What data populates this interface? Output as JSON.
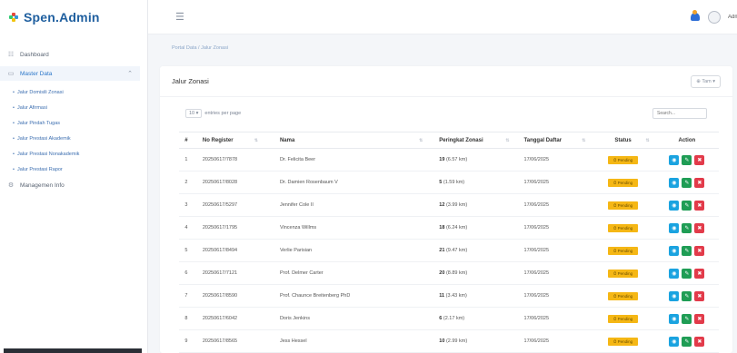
{
  "brand": {
    "name": "Spen.Admin",
    "colors": {
      "primary": "#1f5f9f",
      "accent": "#f5b715"
    }
  },
  "sidebar": {
    "items": [
      {
        "label": "Dashboard",
        "icon": "grid-icon"
      },
      {
        "label": "Master Data",
        "icon": "folder-icon"
      },
      {
        "label": "Managemen Info",
        "icon": "settings-icon"
      }
    ],
    "submenu": [
      {
        "label": "Jalur Domisili Zonasi"
      },
      {
        "label": "Jalur Afirmasi"
      },
      {
        "label": "Jalur Pindah Tugas"
      },
      {
        "label": "Jalur Prestasi Akademik"
      },
      {
        "label": "Jalur Prestasi Nonakademik"
      },
      {
        "label": "Jalur Prestasi Rapor"
      }
    ]
  },
  "header": {
    "user": "Adm"
  },
  "breadcrumb": "Portal Data / Jalur Zonasi",
  "card": {
    "title": "Jalur Zonasi",
    "add_label": "Tam",
    "length_value": "10",
    "length_label": "entries per page",
    "search_placeholder": "Search..."
  },
  "table": {
    "headers": [
      "#",
      "No Register",
      "Nama",
      "Peringkat Zonasi",
      "Tanggal Daftar",
      "Status",
      "Action"
    ],
    "rows": [
      {
        "no": "1",
        "reg": "20250617/7878",
        "nama": "Dr. Felicita Beer",
        "rank": "19",
        "dist": "(6.57 km)",
        "tgl": "17/06/2025",
        "status": "Pending"
      },
      {
        "no": "2",
        "reg": "20250617/8028",
        "nama": "Dr. Damien Rosenbaum V",
        "rank": "5",
        "dist": "(1.59 km)",
        "tgl": "17/06/2025",
        "status": "Pending"
      },
      {
        "no": "3",
        "reg": "20250617/5297",
        "nama": "Jennifer Cole II",
        "rank": "12",
        "dist": "(3.99 km)",
        "tgl": "17/06/2025",
        "status": "Pending"
      },
      {
        "no": "4",
        "reg": "20250617/1795",
        "nama": "Vincenza Willms",
        "rank": "18",
        "dist": "(6.24 km)",
        "tgl": "17/06/2025",
        "status": "Pending"
      },
      {
        "no": "5",
        "reg": "20250617/8494",
        "nama": "Verlie Parisian",
        "rank": "21",
        "dist": "(9.47 km)",
        "tgl": "17/06/2025",
        "status": "Pending"
      },
      {
        "no": "6",
        "reg": "20250617/7121",
        "nama": "Prof. Delmer Carter",
        "rank": "20",
        "dist": "(8.89 km)",
        "tgl": "17/06/2025",
        "status": "Pending"
      },
      {
        "no": "7",
        "reg": "20250617/8590",
        "nama": "Prof. Chaunce Breitenberg PhD",
        "rank": "11",
        "dist": "(3.43 km)",
        "tgl": "17/06/2025",
        "status": "Pending"
      },
      {
        "no": "8",
        "reg": "20250617/6042",
        "nama": "Doris Jenkins",
        "rank": "6",
        "dist": "(2.17 km)",
        "tgl": "17/06/2025",
        "status": "Pending"
      },
      {
        "no": "9",
        "reg": "20250617/8565",
        "nama": "Jess Hessel",
        "rank": "10",
        "dist": "(2.99 km)",
        "tgl": "17/06/2025",
        "status": "Pending"
      }
    ]
  }
}
